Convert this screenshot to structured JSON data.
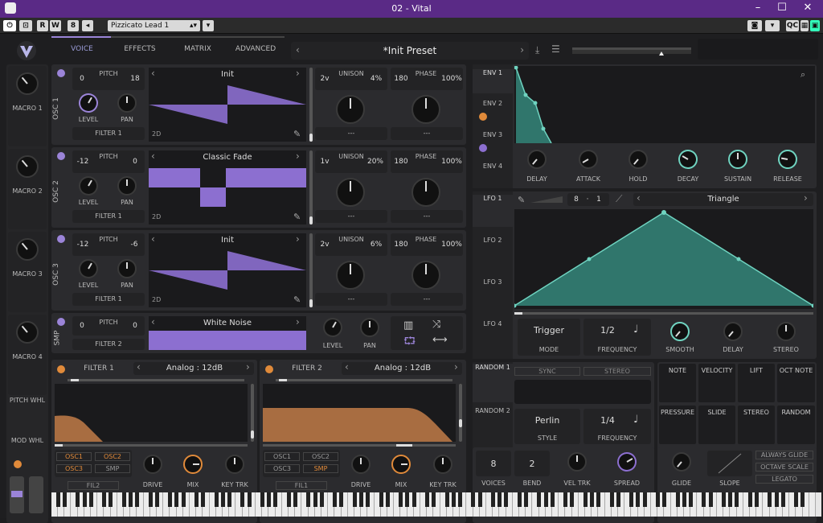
{
  "window": {
    "title": "02 - Vital"
  },
  "host": {
    "buttons": [
      "R",
      "W"
    ],
    "preset_select": "Pizzicato Lead 1",
    "qc_label": "QC"
  },
  "header": {
    "tabs": [
      "VOICE",
      "EFFECTS",
      "MATRIX",
      "ADVANCED"
    ],
    "active_tab": "VOICE",
    "preset_name": "*Init Preset"
  },
  "macros": [
    "MACRO 1",
    "MACRO 2",
    "MACRO 3",
    "MACRO 4"
  ],
  "wheels": {
    "pitch": "PITCH WHL",
    "mod": "MOD WHL"
  },
  "oscillators": [
    {
      "label": "OSC 1",
      "pitch_left": "0",
      "pitch_label": "PITCH",
      "pitch_right": "18",
      "wave_name": "Init",
      "dim": "2D",
      "unison_voices": "2v",
      "unison_label": "UNISON",
      "unison_detune": "4%",
      "phase_val": "180",
      "phase_label": "PHASE",
      "phase_pct": "100%",
      "level": "LEVEL",
      "pan": "PAN",
      "filter": "FILTER 1",
      "dash1": "---",
      "dash2": "---"
    },
    {
      "label": "OSC 2",
      "pitch_left": "-12",
      "pitch_label": "PITCH",
      "pitch_right": "0",
      "wave_name": "Classic Fade",
      "dim": "2D",
      "unison_voices": "1v",
      "unison_label": "UNISON",
      "unison_detune": "20%",
      "phase_val": "180",
      "phase_label": "PHASE",
      "phase_pct": "100%",
      "level": "LEVEL",
      "pan": "PAN",
      "filter": "FILTER 1",
      "dash1": "---",
      "dash2": "---"
    },
    {
      "label": "OSC 3",
      "pitch_left": "-12",
      "pitch_label": "PITCH",
      "pitch_right": "-6",
      "wave_name": "Init",
      "dim": "2D",
      "unison_voices": "2v",
      "unison_label": "UNISON",
      "unison_detune": "6%",
      "phase_val": "180",
      "phase_label": "PHASE",
      "phase_pct": "100%",
      "level": "LEVEL",
      "pan": "PAN",
      "filter": "FILTER 1",
      "dash1": "---",
      "dash2": "---"
    }
  ],
  "sampler": {
    "label": "SMP",
    "pitch_left": "0",
    "pitch_label": "PITCH",
    "pitch_right": "0",
    "sample": "White Noise",
    "filter": "FILTER 2",
    "level": "LEVEL",
    "pan": "PAN"
  },
  "filters": [
    {
      "title": "FILTER 1",
      "type": "Analog : 12dB",
      "routes": [
        "OSC1",
        "OSC2",
        "OSC3",
        "SMP"
      ],
      "fx": "FIL2",
      "drive": "DRIVE",
      "mix": "MIX",
      "keytrk": "KEY TRK"
    },
    {
      "title": "FILTER 2",
      "type": "Analog : 12dB",
      "routes": [
        "OSC1",
        "OSC2",
        "OSC3",
        "SMP"
      ],
      "fx": "FIL1",
      "drive": "DRIVE",
      "mix": "MIX",
      "keytrk": "KEY TRK"
    }
  ],
  "envelopes": {
    "tabs": [
      "ENV 1",
      "ENV 2",
      "ENV 3",
      "ENV 4"
    ],
    "knobs": [
      "DELAY",
      "ATTACK",
      "HOLD",
      "DECAY",
      "SUSTAIN",
      "RELEASE"
    ]
  },
  "lfos": {
    "tabs": [
      "LFO 1",
      "LFO 2",
      "LFO 3",
      "LFO 4"
    ],
    "rate_num": "8",
    "rate_den": "1",
    "shape": "Triangle",
    "mode": "Trigger",
    "mode_label": "MODE",
    "frequency": "1/2",
    "frequency_label": "FREQUENCY",
    "knobs": [
      "SMOOTH",
      "DELAY",
      "STEREO"
    ]
  },
  "randoms": {
    "tabs": [
      "RANDOM 1",
      "RANDOM 2"
    ],
    "sync": "SYNC",
    "stereo": "STEREO",
    "style": "Perlin",
    "style_label": "STYLE",
    "frequency": "1/4",
    "frequency_label": "FREQUENCY"
  },
  "mod_sources": [
    "NOTE",
    "VELOCITY",
    "LIFT",
    "OCT NOTE",
    "PRESSURE",
    "SLIDE",
    "STEREO",
    "RANDOM"
  ],
  "voice": {
    "voices": "8",
    "voices_label": "VOICES",
    "bend": "2",
    "bend_label": "BEND",
    "veltrk": "VEL TRK",
    "spread": "SPREAD",
    "glide": "GLIDE",
    "slope": "SLOPE",
    "always_glide": "ALWAYS GLIDE",
    "octave_scale": "OCTAVE SCALE",
    "legato": "LEGATO"
  }
}
